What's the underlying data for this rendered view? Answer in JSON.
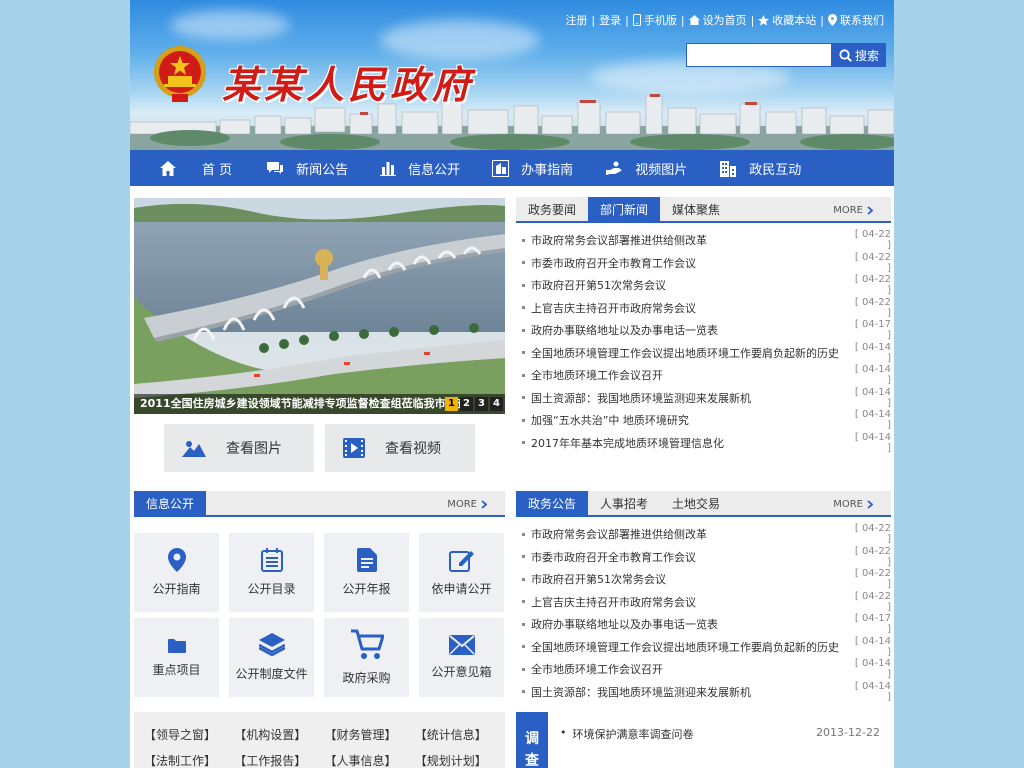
{
  "site": {
    "title": "某某人民政府"
  },
  "toplinks": [
    {
      "label": "注册"
    },
    {
      "label": "登录"
    },
    {
      "label": "手机版"
    },
    {
      "label": "设为首页"
    },
    {
      "label": "收藏本站"
    },
    {
      "label": "联系我们"
    }
  ],
  "search": {
    "placeholder": "",
    "button_label": "搜索"
  },
  "nav": [
    {
      "label": "首 页",
      "icon": "home-icon"
    },
    {
      "label": "新闻公告",
      "icon": "chat-icon"
    },
    {
      "label": "信息公开",
      "icon": "bar-chart-icon"
    },
    {
      "label": "办事指南",
      "icon": "guide-icon"
    },
    {
      "label": "视频图片",
      "icon": "hand-icon"
    },
    {
      "label": "政民互动",
      "icon": "building-icon"
    }
  ],
  "slideshow": {
    "caption": "2011全国住房城乡建设领域节能减排专项监督检查组莅临我市督查",
    "pages": [
      "1",
      "2",
      "3",
      "4"
    ],
    "active_page": "1"
  },
  "media_buttons": {
    "photos": "查看图片",
    "videos": "查看视频"
  },
  "news_panel": {
    "tabs": [
      "政务要闻",
      "部门新闻",
      "媒体聚焦"
    ],
    "active_tab": 1,
    "more": "MORE",
    "items": [
      {
        "title": "市政府常务会议部署推进供给侧改革",
        "date": "[ 04-22 ]"
      },
      {
        "title": "市委市政府召开全市教育工作会议",
        "date": "[ 04-22 ]"
      },
      {
        "title": "市政府召开第51次常务会议",
        "date": "[ 04-22 ]"
      },
      {
        "title": "上官吉庆主持召开市政府常务会议",
        "date": "[ 04-22 ]"
      },
      {
        "title": "政府办事联络地址以及办事电话一览表",
        "date": "[ 04-17 ]"
      },
      {
        "title": "全国地质环境管理工作会议提出地质环境工作要肩负起新的历史",
        "date": "[ 04-14 ]"
      },
      {
        "title": "全市地质环境工作会议召开",
        "date": "[ 04-14 ]"
      },
      {
        "title": "国土资源部：我国地质环境监测迎来发展新机",
        "date": "[ 04-14 ]"
      },
      {
        "title": "加强“五水共治”中 地质环境研究",
        "date": "[ 04-14 ]"
      },
      {
        "title": "2017年年基本完成地质环境管理信息化",
        "date": "[ 04-14 ]"
      }
    ]
  },
  "info_panel": {
    "tabs": [
      "信息公开"
    ],
    "active_tab": 0,
    "more": "MORE",
    "tiles": [
      {
        "label": "公开指南",
        "icon": "location-pin-icon"
      },
      {
        "label": "公开目录",
        "icon": "list-icon"
      },
      {
        "label": "公开年报",
        "icon": "document-icon"
      },
      {
        "label": "依申请公开",
        "icon": "edit-icon"
      },
      {
        "label": "重点项目",
        "icon": "folder-icon"
      },
      {
        "label": "公开制度文件",
        "icon": "layers-icon"
      },
      {
        "label": "政府采购",
        "icon": "cart-icon"
      },
      {
        "label": "公开意见箱",
        "icon": "mail-icon"
      }
    ]
  },
  "notice_panel": {
    "tabs": [
      "政务公告",
      "人事招考",
      "土地交易"
    ],
    "active_tab": 0,
    "more": "MORE",
    "items": [
      {
        "title": "市政府常务会议部署推进供给侧改革",
        "date": "[ 04-22 ]"
      },
      {
        "title": "市委市政府召开全市教育工作会议",
        "date": "[ 04-22 ]"
      },
      {
        "title": "市政府召开第51次常务会议",
        "date": "[ 04-22 ]"
      },
      {
        "title": "上官吉庆主持召开市政府常务会议",
        "date": "[ 04-22 ]"
      },
      {
        "title": "政府办事联络地址以及办事电话一览表",
        "date": "[ 04-17 ]"
      },
      {
        "title": "全国地质环境管理工作会议提出地质环境工作要肩负起新的历史",
        "date": "[ 04-14 ]"
      },
      {
        "title": "全市地质环境工作会议召开",
        "date": "[ 04-14 ]"
      },
      {
        "title": "国土资源部：我国地质环境监测迎来发展新机",
        "date": "[ 04-14 ]"
      }
    ]
  },
  "quick_links": [
    "【领导之窗】",
    "【机构设置】",
    "【财务管理】",
    "【统计信息】",
    "【法制工作】",
    "【工作报告】",
    "【人事信息】",
    "【规划计划】"
  ],
  "survey": {
    "label_1": "调",
    "label_2": "查",
    "item_title": "环境保护满意率调查问卷",
    "item_date": "2013-12-22"
  },
  "colors": {
    "primary": "#2a5fc4",
    "title_red": "#d11b17",
    "page_bg": "#a6d2ec",
    "active_page": "#f0b400"
  }
}
